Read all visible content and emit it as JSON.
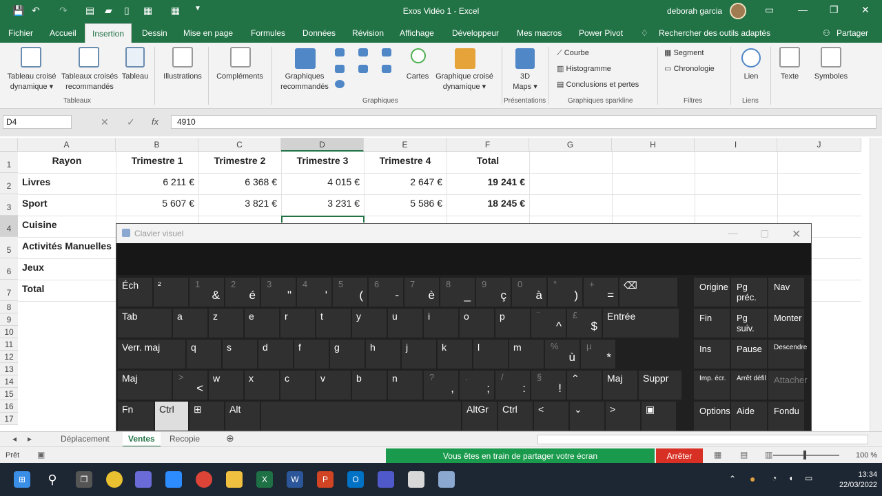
{
  "window": {
    "title": "Exos Vidéo 1  -  Excel",
    "user": "deborah garcia"
  },
  "ribbon_tabs": [
    "Fichier",
    "Accueil",
    "Insertion",
    "Dessin",
    "Mise en page",
    "Formules",
    "Données",
    "Révision",
    "Affichage",
    "Développeur",
    "Mes macros",
    "Power Pivot"
  ],
  "active_tab": "Insertion",
  "search_tools": "Rechercher des outils adaptés",
  "share_label": "Partager",
  "ribbon": {
    "tableau_croise": "Tableau croisé",
    "dynamique": "dynamique",
    "tableaux_croises": "Tableaux croisés",
    "recommandes": "recommandés",
    "tableau": "Tableau",
    "group_tableaux": "Tableaux",
    "illustrations": "Illustrations",
    "complements": "Compléments",
    "graphiques": "Graphiques",
    "graphiques_recommandes": "recommandés",
    "cartes": "Cartes",
    "graphique_croise": "Graphique croisé",
    "graphique_croise_2": "dynamique",
    "group_graphiques": "Graphiques",
    "maps_3d": "3D",
    "maps_3d_2": "Maps",
    "group_presentations": "Présentations",
    "courbe": "Courbe",
    "histogramme": "Histogramme",
    "conclusions": "Conclusions et pertes",
    "group_sparkline": "Graphiques sparkline",
    "segment": "Segment",
    "chronologie": "Chronologie",
    "group_filtres": "Filtres",
    "lien": "Lien",
    "group_liens": "Liens",
    "texte": "Texte",
    "symboles": "Symboles"
  },
  "formula_bar": {
    "cell_ref": "D4",
    "formula": "4910"
  },
  "columns": [
    "A",
    "B",
    "C",
    "D",
    "E",
    "F",
    "G",
    "H",
    "I",
    "J"
  ],
  "rows": [
    "1",
    "2",
    "3",
    "4",
    "5",
    "6",
    "7",
    "8",
    "9",
    "10",
    "11",
    "12",
    "13",
    "14",
    "15",
    "16",
    "17"
  ],
  "table": {
    "headers": [
      "Rayon",
      "Trimestre 1",
      "Trimestre 2",
      "Trimestre 3",
      "Trimestre 4",
      "Total"
    ],
    "rows": [
      {
        "label": "Livres",
        "values": [
          "6 211 €",
          "6 368 €",
          "4 015 €",
          "2 647 €"
        ],
        "total": "19 241 €"
      },
      {
        "label": "Sport",
        "values": [
          "5 607 €",
          "3 821 €",
          "3 231 €",
          "5 586 €"
        ],
        "total": "18 245 €"
      }
    ],
    "more_labels": [
      "Cuisine",
      "Activités Manuelles",
      "Jeux",
      "Total"
    ]
  },
  "osk": {
    "title": "Clavier visuel",
    "row1": [
      {
        "k": "Éch"
      },
      {
        "k": "²"
      },
      {
        "s": "1",
        "m": "&"
      },
      {
        "s": "2",
        "m": "é"
      },
      {
        "s": "3",
        "m": "\""
      },
      {
        "s": "4",
        "m": "'"
      },
      {
        "s": "5",
        "m": "("
      },
      {
        "s": "6",
        "m": "-"
      },
      {
        "s": "7",
        "m": "è"
      },
      {
        "s": "8",
        "m": "_"
      },
      {
        "s": "9",
        "m": "ç"
      },
      {
        "s": "0",
        "m": "à"
      },
      {
        "s": "°",
        "m": ")"
      },
      {
        "s": "+",
        "m": "="
      },
      {
        "k": "⌫"
      }
    ],
    "row2": [
      {
        "k": "Tab"
      },
      {
        "k": "a"
      },
      {
        "k": "z"
      },
      {
        "k": "e"
      },
      {
        "k": "r"
      },
      {
        "k": "t"
      },
      {
        "k": "y"
      },
      {
        "k": "u"
      },
      {
        "k": "i"
      },
      {
        "k": "o"
      },
      {
        "k": "p"
      },
      {
        "s": "¨",
        "m": "^"
      },
      {
        "s": "£",
        "m": "$"
      },
      {
        "k": "Entrée"
      }
    ],
    "row3": [
      {
        "k": "Verr. maj"
      },
      {
        "k": "q"
      },
      {
        "k": "s"
      },
      {
        "k": "d"
      },
      {
        "k": "f"
      },
      {
        "k": "g"
      },
      {
        "k": "h"
      },
      {
        "k": "j"
      },
      {
        "k": "k"
      },
      {
        "k": "l"
      },
      {
        "k": "m"
      },
      {
        "s": "%",
        "m": "ù"
      },
      {
        "s": "µ",
        "m": "*"
      }
    ],
    "row4": [
      {
        "k": "Maj"
      },
      {
        "s": ">",
        "m": "<"
      },
      {
        "k": "w"
      },
      {
        "k": "x"
      },
      {
        "k": "c"
      },
      {
        "k": "v"
      },
      {
        "k": "b"
      },
      {
        "k": "n"
      },
      {
        "s": "?",
        "m": ","
      },
      {
        "s": ".",
        "m": ";"
      },
      {
        "s": "/",
        "m": ":"
      },
      {
        "s": "§",
        "m": "!"
      },
      {
        "k": "⌃"
      },
      {
        "k": "Maj"
      },
      {
        "k": "Suppr"
      }
    ],
    "row5": [
      {
        "k": "Fn"
      },
      {
        "k": "Ctrl"
      },
      {
        "k": "⊞"
      },
      {
        "k": "Alt"
      },
      {
        "k": ""
      },
      {
        "k": "AltGr"
      },
      {
        "k": "Ctrl"
      },
      {
        "k": "<"
      },
      {
        "k": "⌄"
      },
      {
        "k": ">"
      },
      {
        "k": "▣"
      }
    ],
    "right": [
      [
        "Origine",
        "Pg préc.",
        "Nav"
      ],
      [
        "Fin",
        "Pg suiv.",
        "Monter"
      ],
      [
        "Ins",
        "Pause",
        "Descendre"
      ],
      [
        "Imp. écr.",
        "Arrêt défil",
        "Attacher"
      ],
      [
        "Options",
        "Aide",
        "Fondu"
      ]
    ]
  },
  "sheet_tabs": [
    "Déplacement",
    "Ventes",
    "Recopie"
  ],
  "active_sheet": "Ventes",
  "status": {
    "ready": "Prêt",
    "sharing": "Vous êtes en train de partager votre écran",
    "stop": "Arrêter",
    "zoom": "100 %"
  },
  "clock": {
    "time": "13:34",
    "date": "22/03/2022"
  }
}
